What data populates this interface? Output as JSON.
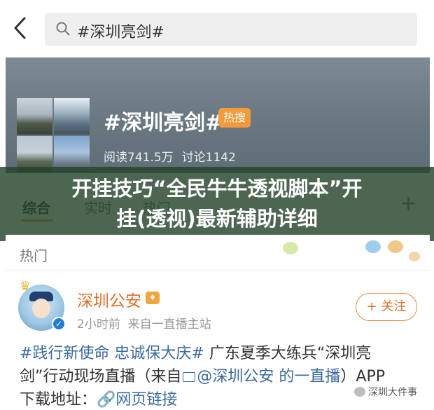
{
  "header": {
    "search_query": "#深圳亮剑#"
  },
  "topic": {
    "title": "#深圳亮剑#",
    "badge": "热搜",
    "reads": "阅读741.5万",
    "discussions": "讨论1142"
  },
  "tabs": [
    {
      "label": "综合",
      "active": true
    },
    {
      "label": "实时",
      "active": false
    },
    {
      "label": "热门",
      "active": false
    }
  ],
  "overlay_caption_line1": "开挂技巧“全民牛牛透视脚本”开",
  "overlay_caption_line2": "挂(透视)最新辅助详细",
  "section_label": "热门",
  "post": {
    "author": "深圳公安",
    "time": "2小时前",
    "source": "来自一直播主站",
    "follow_label": "+ 关注",
    "line1_tag": "#践行新使命 忠诚保大庆#",
    "line1_text": " 广东夏季大练兵“深圳亮",
    "line2_text": "剑”行动现场直播（来自",
    "line2_link": "@深圳公安 的一直播",
    "line2_tail": "）APP",
    "line3_text": "下载地址：",
    "line3_link": "网页链接",
    "watermark": "深圳大件事"
  },
  "colors": {
    "accent": "#e56e26",
    "link": "#3a6aa0",
    "hot_badge": "#f39a3a",
    "overlay": "#26442c"
  }
}
